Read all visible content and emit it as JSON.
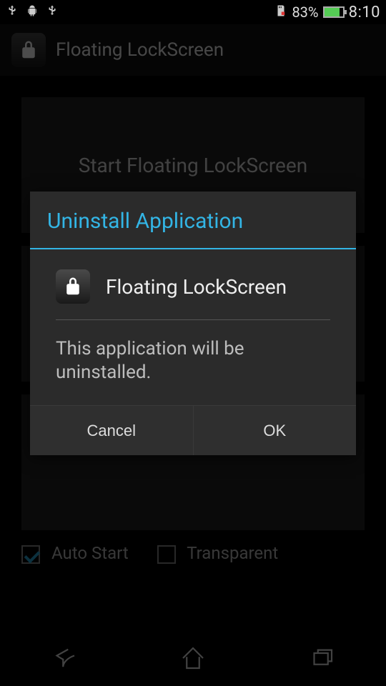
{
  "status_bar": {
    "battery_pct": "83%",
    "clock": "8:10"
  },
  "action_bar": {
    "title": "Floating LockScreen"
  },
  "content": {
    "start_label": "Start Floating LockScreen",
    "auto_start_label": "Auto Start",
    "auto_start_checked": true,
    "transparent_label": "Transparent",
    "transparent_checked": false
  },
  "dialog": {
    "title": "Uninstall Application",
    "app_name": "Floating LockScreen",
    "message": "This application will be uninstalled.",
    "cancel_label": "Cancel",
    "ok_label": "OK"
  }
}
